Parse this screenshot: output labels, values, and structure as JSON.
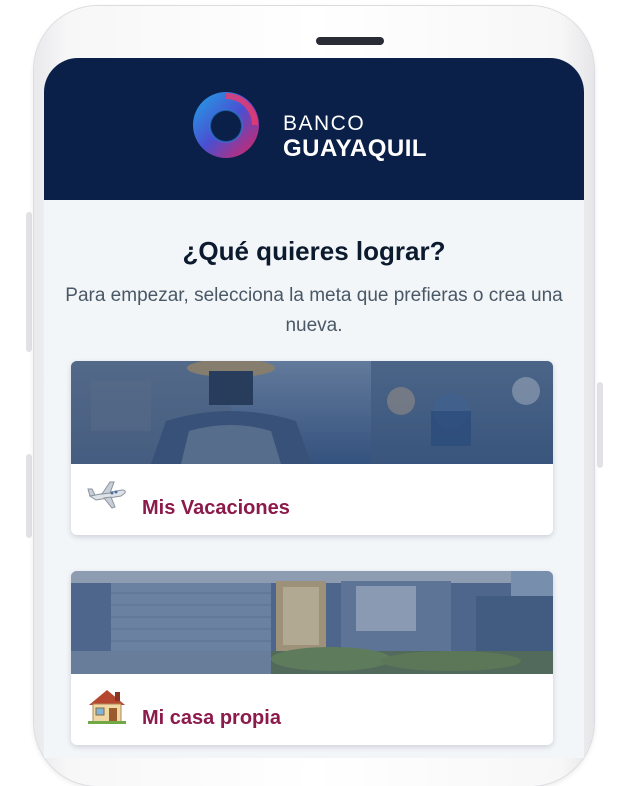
{
  "app": {
    "brand_line1": "BANCO",
    "brand_line2": "GUAYAQUIL"
  },
  "main": {
    "title": "¿Qué quieres lograr?",
    "subtitle": "Para empezar, selecciona la meta que prefieras o crea una nueva."
  },
  "goals": [
    {
      "label": "Mis Vacaciones",
      "icon": "airplane-icon"
    },
    {
      "label": "Mi casa propia",
      "icon": "house-icon"
    }
  ],
  "colors": {
    "header_bg": "#0a2048",
    "goal_label": "#8c1a4b",
    "title": "#0c1a2e",
    "screen_bg": "#f3f6f9"
  }
}
